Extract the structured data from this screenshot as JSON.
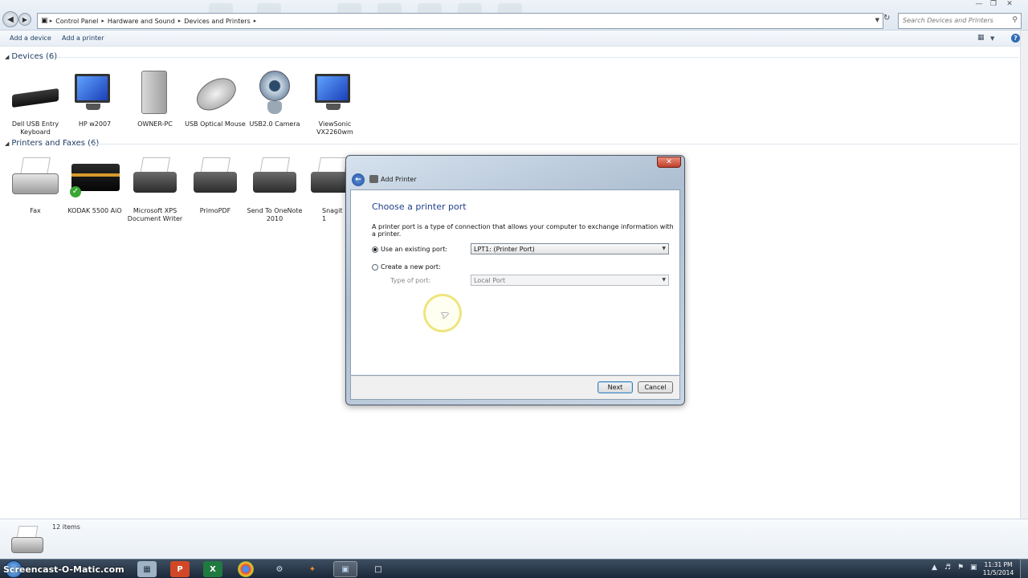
{
  "window": {
    "breadcrumb": [
      "Control Panel",
      "Hardware and Sound",
      "Devices and Printers"
    ],
    "search_placeholder": "Search Devices and Printers"
  },
  "commandbar": {
    "add_device": "Add a device",
    "add_printer": "Add a printer"
  },
  "devices": {
    "header": "Devices (6)",
    "items": [
      {
        "label": "Dell USB Entry Keyboard",
        "icon": "keyboard-icon"
      },
      {
        "label": "HP w2007",
        "icon": "monitor-icon"
      },
      {
        "label": "OWNER-PC",
        "icon": "computer-icon"
      },
      {
        "label": "USB Optical Mouse",
        "icon": "mouse-icon"
      },
      {
        "label": "USB2.0 Camera",
        "icon": "webcam-icon"
      },
      {
        "label": "ViewSonic VX2260wm",
        "icon": "monitor-icon"
      }
    ]
  },
  "printers": {
    "header": "Printers and Faxes (6)",
    "items": [
      {
        "label": "Fax",
        "icon": "fax-icon"
      },
      {
        "label": "KODAK 5500 AiO",
        "icon": "printer-icon",
        "default": true
      },
      {
        "label": "Microsoft XPS Document Writer",
        "icon": "printer-icon"
      },
      {
        "label": "PrimoPDF",
        "icon": "printer-icon"
      },
      {
        "label": "Send To OneNote 2010",
        "icon": "printer-icon"
      },
      {
        "label": "Snagit 1",
        "icon": "printer-icon"
      }
    ]
  },
  "dialog": {
    "title": "Add Printer",
    "heading": "Choose a printer port",
    "description": "A printer port is a type of connection that allows your computer to exchange information with a printer.",
    "existing_port_label": "Use an existing port:",
    "existing_port_value": "LPT1: (Printer Port)",
    "new_port_label": "Create a new port:",
    "type_of_port_label": "Type of port:",
    "type_of_port_value": "Local Port",
    "selected_option": "existing",
    "next_label": "Next",
    "cancel_label": "Cancel"
  },
  "details": {
    "count": "12 items"
  },
  "taskbar": {
    "watermark": "Screencast-O-Matic.com",
    "time": "11:31 PM",
    "date": "11/5/2014",
    "apps": [
      "explorer",
      "calculator",
      "powerpoint",
      "excel",
      "chrome",
      "app",
      "app",
      "control-panel",
      "snipping-tool"
    ]
  },
  "colors": {
    "accent": "#1e3f8a",
    "taskbar": "#1b2838",
    "close": "#c0412b"
  }
}
